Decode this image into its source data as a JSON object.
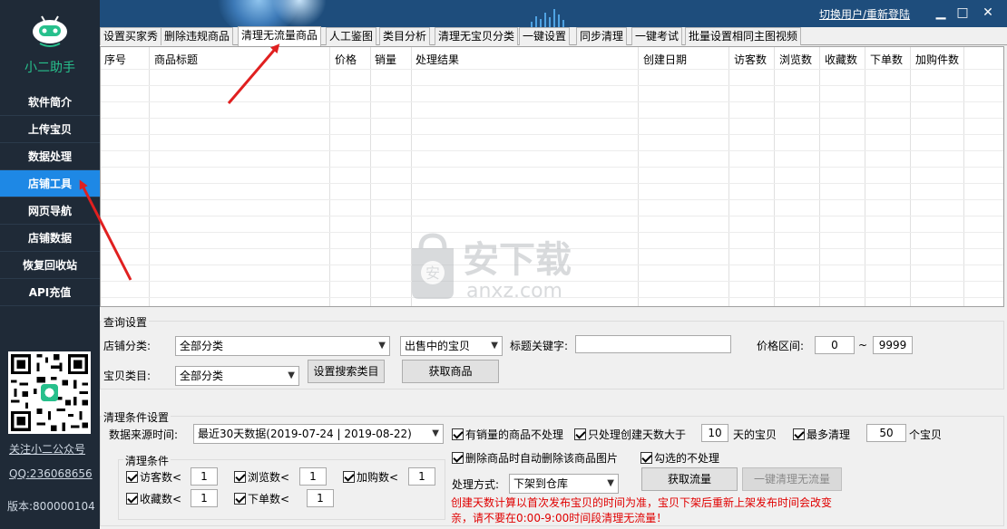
{
  "window": {
    "switch_user": "切换用户/重新登陆",
    "minimize": "▁",
    "maximize": "□",
    "close": "✕"
  },
  "sidebar": {
    "brand": "小二助手",
    "items": [
      {
        "label": "软件简介",
        "active": false
      },
      {
        "label": "上传宝贝",
        "active": false
      },
      {
        "label": "数据处理",
        "active": false
      },
      {
        "label": "店铺工具",
        "active": true
      },
      {
        "label": "网页导航",
        "active": false
      },
      {
        "label": "店铺数据",
        "active": false
      },
      {
        "label": "恢复回收站",
        "active": false
      },
      {
        "label": "API充值",
        "active": false
      }
    ],
    "follow_link": "关注小二公众号",
    "qq": "QQ:236068656",
    "version": "版本:800000104"
  },
  "tabs": [
    {
      "label": "设置买家秀",
      "active": false
    },
    {
      "label": "删除违规商品",
      "active": false
    },
    {
      "label": "清理无流量商品",
      "active": true
    },
    {
      "label": "人工鉴图",
      "active": false
    },
    {
      "label": "类目分析",
      "active": false
    },
    {
      "label": "清理无宝贝分类",
      "active": false
    },
    {
      "label": "一键设置",
      "active": false
    },
    {
      "label": "同步清理",
      "active": false
    },
    {
      "label": "一键考试",
      "active": false
    },
    {
      "label": "批量设置相同主图视频",
      "active": false
    }
  ],
  "grid": {
    "columns": [
      "序号",
      "商品标题",
      "价格",
      "销量",
      "处理结果",
      "创建日期",
      "访客数",
      "浏览数",
      "收藏数",
      "下单数",
      "加购件数"
    ],
    "rows": []
  },
  "watermark": {
    "main": "安下载",
    "sub": "anxz.com"
  },
  "query": {
    "title": "查询设置",
    "shop_category_label": "店铺分类:",
    "shop_category_value": "全部分类",
    "status_value": "出售中的宝贝",
    "keyword_label": "标题关键字:",
    "keyword_value": "",
    "price_label": "价格区间:",
    "price_min": "0",
    "price_sep": "~",
    "price_max": "9999",
    "item_category_label": "宝贝类目:",
    "item_category_value": "全部分类",
    "set_category_button": "设置搜索类目",
    "get_items_button": "获取商品"
  },
  "clean": {
    "title": "清理条件设置",
    "source_time_label": "数据来源时间:",
    "source_time_value": "最近30天数据(2019-07-24 | 2019-08-22)",
    "cond_title": "清理条件",
    "visitors_label": "访客数<",
    "visitors_value": "1",
    "views_label": "浏览数<",
    "views_value": "1",
    "carts_label": "加购数<",
    "carts_value": "1",
    "favs_label": "收藏数<",
    "favs_value": "1",
    "orders_label": "下单数<",
    "orders_value": "1",
    "skip_sold_label": "有销量的商品不处理",
    "only_days_label": "只处理创建天数大于",
    "only_days_value": "10",
    "days_suffix": "天的宝贝",
    "max_label": "最多清理",
    "max_value": "50",
    "max_suffix": "个宝贝",
    "auto_delete_img_label": "删除商品时自动删除该商品图片",
    "skip_checked_label": "勾选的不处理",
    "method_label": "处理方式:",
    "method_value": "下架到仓库",
    "get_traffic_button": "获取流量",
    "one_click_clean_button": "一键清理无流量",
    "note_line1": "创建天数计算以首次发布宝贝的时间为准，宝贝下架后重新上架发布时间会改变",
    "note_line2": "conf",
    "note_line2_text": "亲，请不要在0:00-9:00时间段清理无流量！"
  },
  "colors": {
    "sidebar_bg": "#1f2a37",
    "active_nav": "#1e88e5",
    "brand_green": "#27c08c",
    "title_bar": "#1e4d7c",
    "note_red": "#e00000",
    "arrow_red": "#e02020"
  }
}
